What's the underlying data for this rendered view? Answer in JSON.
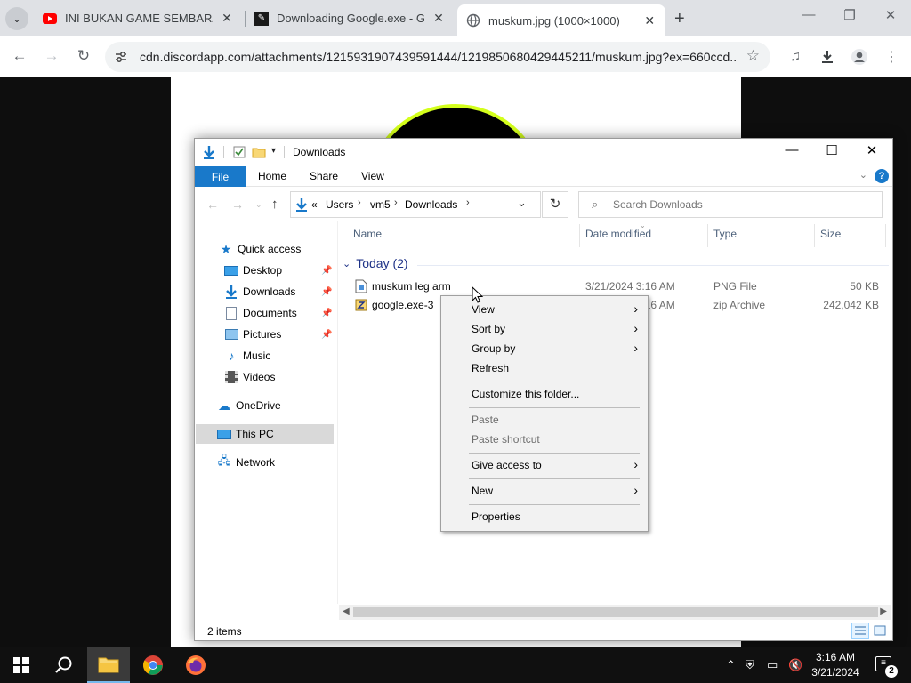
{
  "browser": {
    "tabs": [
      {
        "title": "INI BUKAN GAME SEMBARANG",
        "favicon": "youtube-icon",
        "active": false
      },
      {
        "title": "Downloading Google.exe - Gar",
        "favicon": "game-site-icon",
        "active": false
      },
      {
        "title": "muskum.jpg (1000×1000)",
        "favicon": "globe-icon",
        "active": true
      }
    ],
    "url": "cdn.discordapp.com/attachments/1215931907439591444/1219850680429445211/muskum.jpg?ex=660ccd..."
  },
  "explorer": {
    "title": "Downloads",
    "ribbon": {
      "file": "File",
      "home": "Home",
      "share": "Share",
      "view": "View"
    },
    "address": {
      "overflow": "«",
      "crumbs": [
        "Users",
        "vm5",
        "Downloads"
      ]
    },
    "search_placeholder": "Search Downloads",
    "nav": {
      "quick_access": "Quick access",
      "items": [
        {
          "label": "Desktop",
          "pinned": true
        },
        {
          "label": "Downloads",
          "pinned": true
        },
        {
          "label": "Documents",
          "pinned": true
        },
        {
          "label": "Pictures",
          "pinned": true
        },
        {
          "label": "Music",
          "pinned": false
        },
        {
          "label": "Videos",
          "pinned": false
        }
      ],
      "onedrive": "OneDrive",
      "this_pc": "This PC",
      "network": "Network"
    },
    "columns": {
      "name": "Name",
      "date": "Date modified",
      "type": "Type",
      "size": "Size"
    },
    "group": "Today (2)",
    "files": [
      {
        "name": "muskum leg arm",
        "date": "3/21/2024 3:16 AM",
        "type": "PNG File",
        "size": "50 KB"
      },
      {
        "name": "google.exe-3",
        "date": "3/21/2024 3:16 AM",
        "type": "zip Archive",
        "size": "242,042 KB"
      }
    ],
    "status": "2 items"
  },
  "context_menu": {
    "items": [
      {
        "label": "View",
        "submenu": true,
        "disabled": false
      },
      {
        "label": "Sort by",
        "submenu": true,
        "disabled": false
      },
      {
        "label": "Group by",
        "submenu": true,
        "disabled": false
      },
      {
        "label": "Refresh",
        "submenu": false,
        "disabled": false
      },
      {
        "label": "Customize this folder...",
        "submenu": false,
        "disabled": false
      },
      {
        "label": "Paste",
        "submenu": false,
        "disabled": true
      },
      {
        "label": "Paste shortcut",
        "submenu": false,
        "disabled": true
      },
      {
        "label": "Give access to",
        "submenu": true,
        "disabled": false
      },
      {
        "label": "New",
        "submenu": true,
        "disabled": false
      },
      {
        "label": "Properties",
        "submenu": false,
        "disabled": false
      }
    ]
  },
  "taskbar": {
    "time": "3:16 AM",
    "date": "3/21/2024",
    "notifications": "2"
  },
  "colors": {
    "accent": "#1979ca",
    "group_text": "#1e3287",
    "column_text": "#4c607a"
  }
}
